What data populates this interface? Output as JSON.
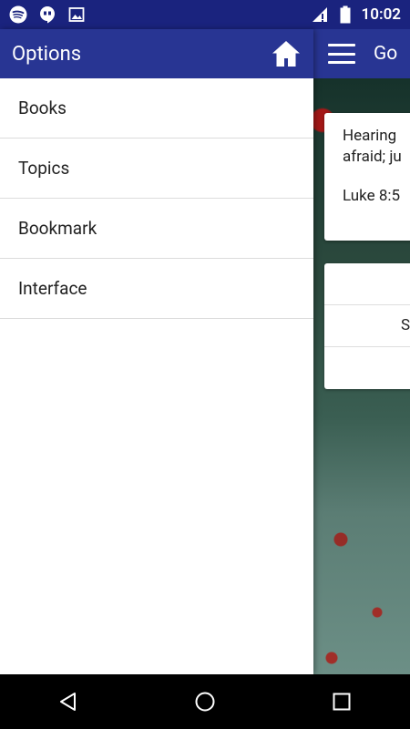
{
  "status_bar": {
    "time": "10:02",
    "left_icons": [
      "spotify-icon",
      "hangouts-icon",
      "image-icon"
    ],
    "right_icons": [
      "signal-icon",
      "battery-icon"
    ]
  },
  "drawer": {
    "title": "Options",
    "home_icon": "home-icon",
    "items": [
      {
        "label": "Books"
      },
      {
        "label": "Topics"
      },
      {
        "label": "Bookmark"
      },
      {
        "label": "Interface"
      }
    ]
  },
  "background_app": {
    "title": "Go",
    "verse": {
      "line1": "Hearing",
      "line2": "afraid; ju",
      "reference": "Luke 8:5"
    },
    "options_rows": [
      "",
      "S",
      ""
    ]
  },
  "nav_bar": {
    "icons": [
      "back-icon",
      "home-circle-icon",
      "recents-icon"
    ]
  },
  "colors": {
    "status_bar": "#1a237e",
    "app_bar": "#283593",
    "drawer_bg": "#ffffff"
  }
}
